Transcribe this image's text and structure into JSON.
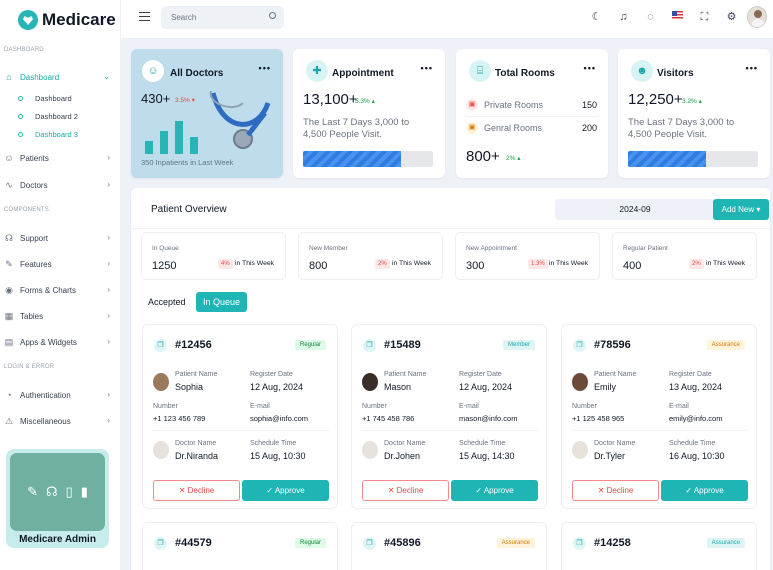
{
  "brand": {
    "name": "Medicare"
  },
  "sidebar": {
    "sections": {
      "dashboard": "DASHBOARD",
      "components": "COMPONENTS",
      "login_error": "LOGIN & ERROR"
    },
    "items": [
      {
        "label": "Dashboard"
      },
      {
        "label": "Patients"
      },
      {
        "label": "Doctors"
      },
      {
        "label": "Support"
      },
      {
        "label": "Features"
      },
      {
        "label": "Forms & Charts"
      },
      {
        "label": "Tables"
      },
      {
        "label": "Apps & Widgets"
      },
      {
        "label": "Authentication"
      },
      {
        "label": "Miscellaneous"
      }
    ],
    "sub_items": [
      {
        "label": "Dashboard"
      },
      {
        "label": "Dashboard 2"
      },
      {
        "label": "Dashboard 3"
      }
    ],
    "admin": {
      "name": "Medicare Admin"
    }
  },
  "header": {
    "search_placeholder": "Search"
  },
  "stats": {
    "all_doctors": {
      "title": "All Doctors",
      "value": "430+",
      "change": "3.5%",
      "caption": "350 Inpatients in Last Week"
    },
    "appointment": {
      "title": "Appointment",
      "value": "13,100+",
      "change": "5.3%",
      "desc": "The Last 7 Days 3,000 to 4,500 People Visit.",
      "progress": 0.75
    },
    "rooms": {
      "title": "Total Rooms",
      "private_label": "Private Rooms",
      "private_value": "150",
      "general_label": "Genral Rooms",
      "general_value": "200",
      "value": "800+",
      "change": "2%"
    },
    "visitors": {
      "title": "Visitors",
      "value": "12,250+",
      "change": "3.2%",
      "desc": "The Last 7 Days 3,000 to 4,500 People Visit.",
      "progress": 0.6
    }
  },
  "overview": {
    "title": "Patient Overview",
    "date": "2024-09",
    "add_new": "Add New",
    "metrics": [
      {
        "label": "In Queue",
        "value": "1250",
        "badge": "4%",
        "period": "in This Week"
      },
      {
        "label": "New Member",
        "value": "800",
        "badge": "2%",
        "period": "in This Week"
      },
      {
        "label": "New Appointment",
        "value": "300",
        "badge": "1.3%",
        "period": "in This Week"
      },
      {
        "label": "Regular Patient",
        "value": "400",
        "badge": "2%",
        "period": "in This Week"
      }
    ],
    "tabs": [
      "Accepted",
      "In Queue"
    ]
  },
  "labels": {
    "patient_name": "Patient Name",
    "register_date": "Register Date",
    "number": "Number",
    "email": "E-mail",
    "doctor_name": "Doctor Name",
    "schedule_time": "Schedule Time",
    "decline": "Decline",
    "approve": "Approve"
  },
  "patients": [
    {
      "id": "#12456",
      "tag": "Regular",
      "name": "Sophia",
      "reg": "12 Aug, 2024",
      "number": "+1 123 456 789",
      "email": "sophia@info.com",
      "doctor": "Dr.Niranda",
      "schedule": "15 Aug, 10:30"
    },
    {
      "id": "#15489",
      "tag": "Member",
      "name": "Mason",
      "reg": "12 Aug, 2024",
      "number": "+1 745 458 786",
      "email": "mason@info.com",
      "doctor": "Dr.Johen",
      "schedule": "15 Aug, 14:30"
    },
    {
      "id": "#78596",
      "tag": "Assurance",
      "name": "Emily",
      "reg": "13 Aug, 2024",
      "number": "+1 125 458 965",
      "email": "emily@info.com",
      "doctor": "Dr.Tyler",
      "schedule": "16 Aug, 10:30"
    },
    {
      "id": "#44579",
      "tag": "Regular"
    },
    {
      "id": "#45896",
      "tag": "Assurance"
    },
    {
      "id": "#14258",
      "tag": "Assurance"
    }
  ]
}
